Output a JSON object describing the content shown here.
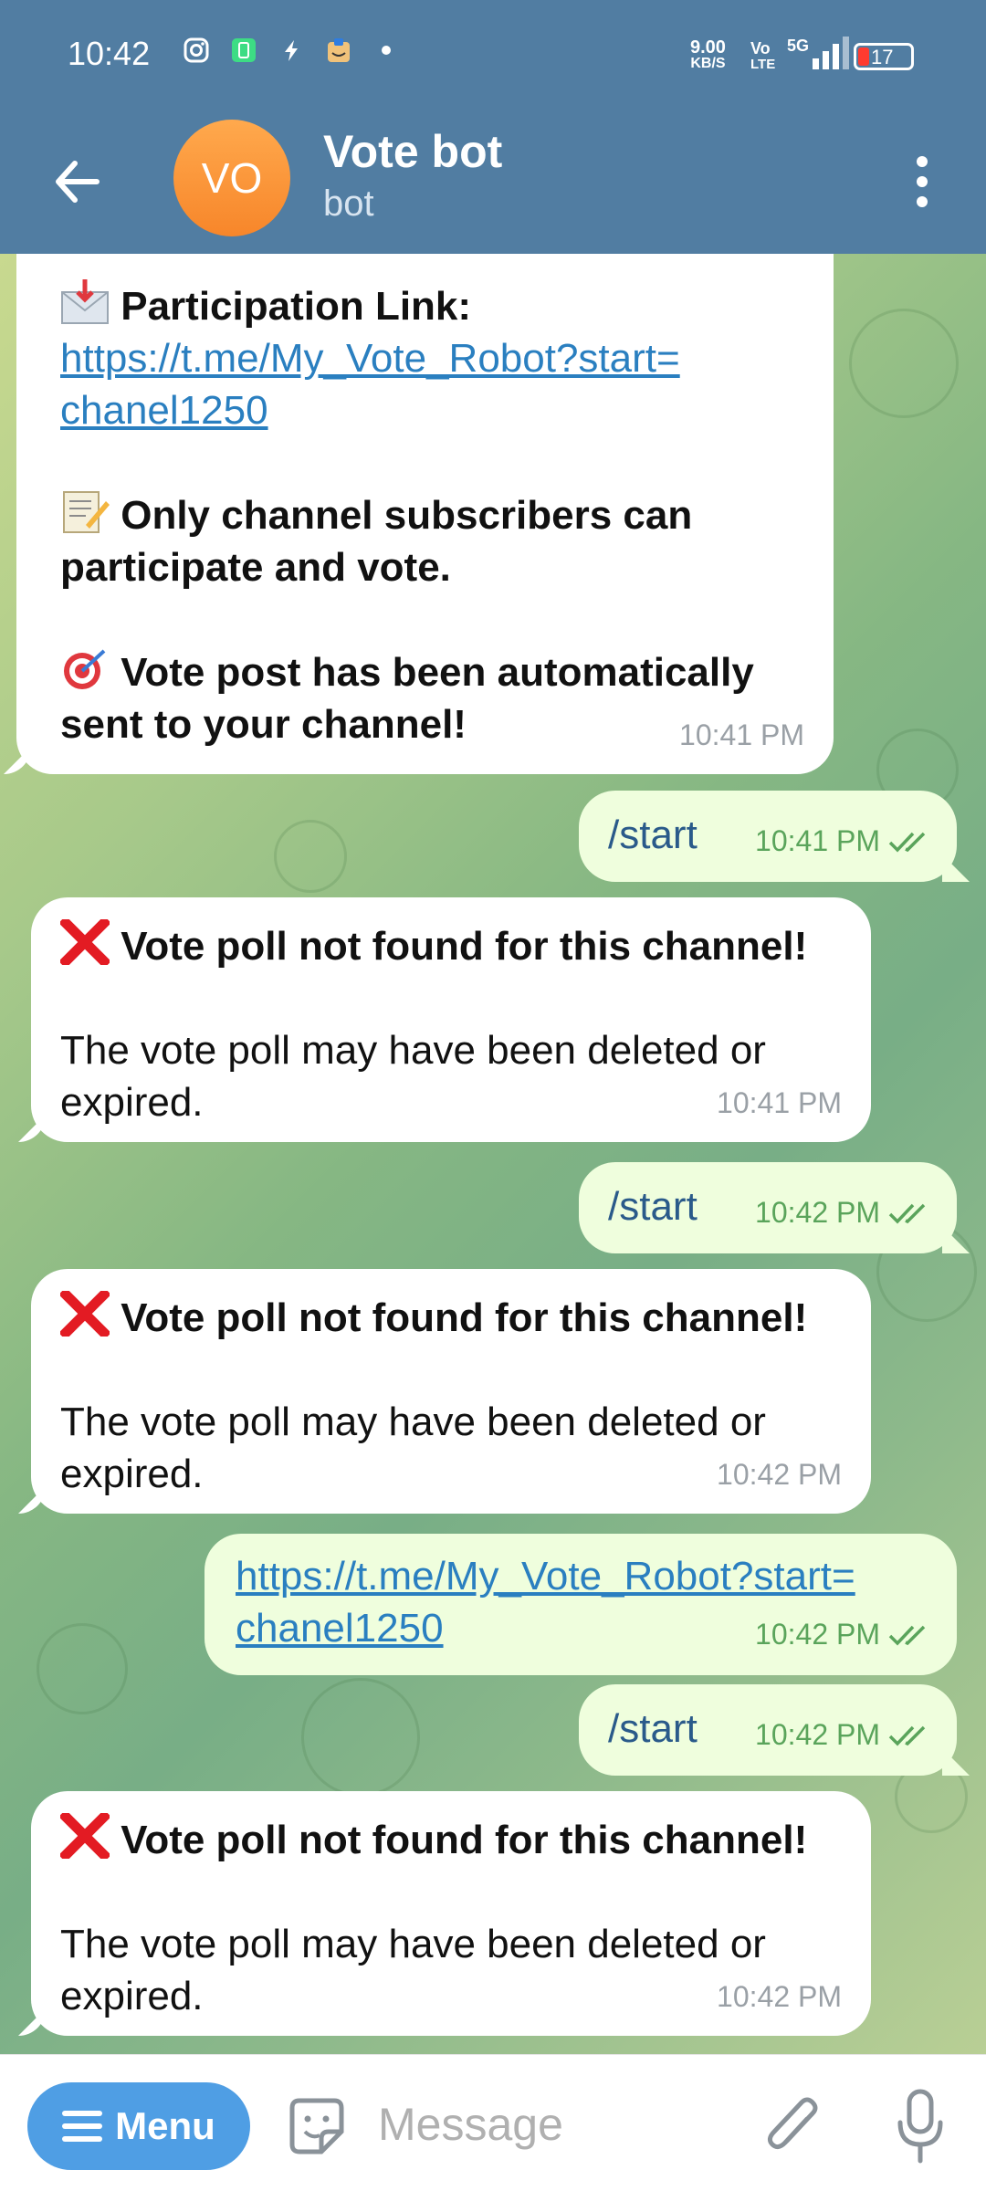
{
  "status_bar": {
    "time": "10:42",
    "net_speed": "9.00",
    "net_unit": "KB/S",
    "volte": "Vo",
    "lte": "LTE",
    "network": "5G",
    "battery": "17"
  },
  "header": {
    "avatar_initials": "VO",
    "title": "Vote bot",
    "subtitle": "bot",
    "avatar_color": "#f7862a"
  },
  "messages": {
    "m1": {
      "participation_label": "Participation Link:",
      "link_line1": "https://t.me/My_Vote_Robot?start=",
      "link_line2": "chanel1250",
      "subscribers_line1": "Only channel subscribers can",
      "subscribers_line2": "participate and vote.",
      "vote_post_line1": "Vote post has been automatically",
      "vote_post_line2": "sent to your channel!",
      "time": "10:41 PM"
    },
    "m2": {
      "text": "/start",
      "time": "10:41 PM"
    },
    "m3": {
      "title": "Vote poll not found for this channel!",
      "body_line1": "The vote poll may have been deleted or",
      "body_line2": "expired.",
      "time": "10:41 PM"
    },
    "m4": {
      "text": "/start",
      "time": "10:42 PM"
    },
    "m5": {
      "title": "Vote poll not found for this channel!",
      "body_line1": "The vote poll may have been deleted or",
      "body_line2": "expired.",
      "time": "10:42 PM"
    },
    "m6": {
      "link_line1": "https://t.me/My_Vote_Robot?start=",
      "link_line2": "chanel1250",
      "time": "10:42 PM"
    },
    "m7": {
      "text": "/start",
      "time": "10:42 PM"
    },
    "m8": {
      "title": "Vote poll not found for this channel!",
      "body_line1": "The vote poll may have been deleted or",
      "body_line2": "expired.",
      "time": "10:42 PM"
    }
  },
  "input_bar": {
    "menu_label": "Menu",
    "message_placeholder": "Message",
    "accent_color": "#4f9ee4"
  },
  "icons": [
    "back-arrow-icon",
    "more-vert-icon",
    "envelope-icon",
    "memo-icon",
    "dart-icon",
    "cross-mark-icon",
    "double-check-icon",
    "sticker-icon",
    "paperclip-icon",
    "microphone-icon"
  ]
}
